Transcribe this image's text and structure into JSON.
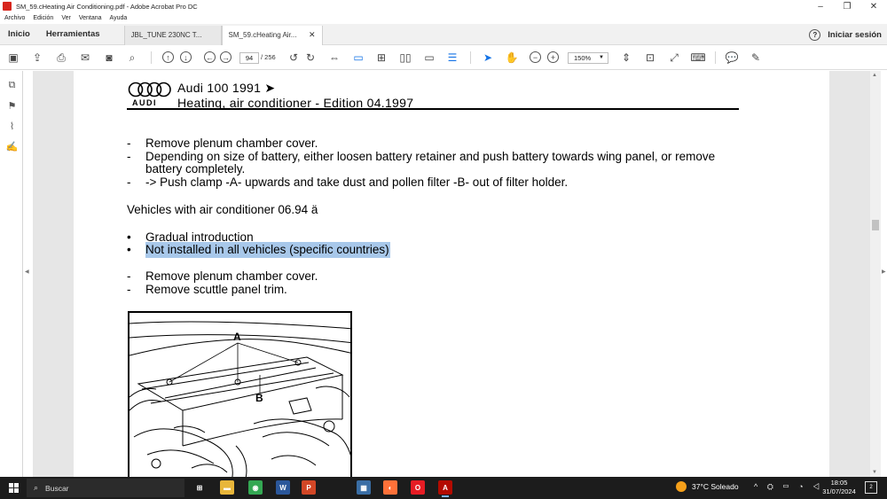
{
  "window": {
    "title": "SM_59.cHeating Air Conditioning.pdf - Adobe Acrobat Pro DC",
    "minimize": "–",
    "maximize": "❐",
    "close": "✕"
  },
  "menu": [
    "Archivo",
    "Edición",
    "Ver",
    "Ventana",
    "Ayuda"
  ],
  "tabs": {
    "home": "Inicio",
    "tools": "Herramientas",
    "docs": [
      {
        "label": "JBL_TUNE 230NC T...",
        "close": "✕",
        "active": false
      },
      {
        "label": "SM_59.cHeating Air...",
        "close": "✕",
        "active": true
      }
    ],
    "help": "?",
    "signin": "Iniciar sesión"
  },
  "toolbar": {
    "page_current": "94",
    "page_total": "/  256",
    "zoom": "150%",
    "zoom_caret": "▼"
  },
  "document": {
    "header": {
      "brand": "AUDI",
      "title_line1": "Audi 100 1991 ➤",
      "title_line2": "Heating, air conditioner - Edition 04.1997"
    },
    "steps_group1": [
      {
        "bullet": "-",
        "lines": [
          "Remove plenum chamber cover."
        ]
      },
      {
        "bullet": "-",
        "lines": [
          "Depending on size of battery, either loosen battery retainer and push battery towards wing panel, or remove",
          "battery completely."
        ]
      },
      {
        "bullet": "-",
        "lines": [
          "-> Push clamp -A- upwards and take dust and pollen filter -B- out of filter holder."
        ]
      }
    ],
    "section_heading": "Vehicles with air conditioner 06.94 ä",
    "bullets": [
      {
        "bullet": "•",
        "text": "Gradual introduction",
        "highlighted": false
      },
      {
        "bullet": "•",
        "text": "Not installed in all vehicles (specific countries)",
        "highlighted": true
      }
    ],
    "steps_group2": [
      {
        "bullet": "-",
        "text": "Remove plenum chamber cover."
      },
      {
        "bullet": "-",
        "text": "Remove scuttle panel trim."
      }
    ],
    "figure_labels": {
      "a": "A",
      "b": "B"
    }
  },
  "taskbar": {
    "search_placeholder": "Buscar",
    "weather": "37°C  Soleado",
    "tray_icons": "^ ⛭ ▭ ◔ ◁",
    "time": "18:05",
    "date": "31/07/2024",
    "notification_count": "2",
    "apps": [
      {
        "name": "task-view",
        "label": "⊞",
        "color": "#1c1c1c"
      },
      {
        "name": "file-explorer",
        "label": "▬",
        "color": "#e8b63a"
      },
      {
        "name": "chrome",
        "label": "◉",
        "color": "#34a853"
      },
      {
        "name": "word",
        "label": "W",
        "color": "#2b579a"
      },
      {
        "name": "powerpoint",
        "label": "P",
        "color": "#d24726"
      },
      {
        "name": "calculator",
        "label": "▦",
        "color": "#3a6ea5"
      },
      {
        "name": "firefox",
        "label": "◐",
        "color": "#ff7139"
      },
      {
        "name": "opera",
        "label": "O",
        "color": "#e61c24"
      },
      {
        "name": "acrobat",
        "label": "A",
        "color": "#b30b00"
      }
    ]
  }
}
